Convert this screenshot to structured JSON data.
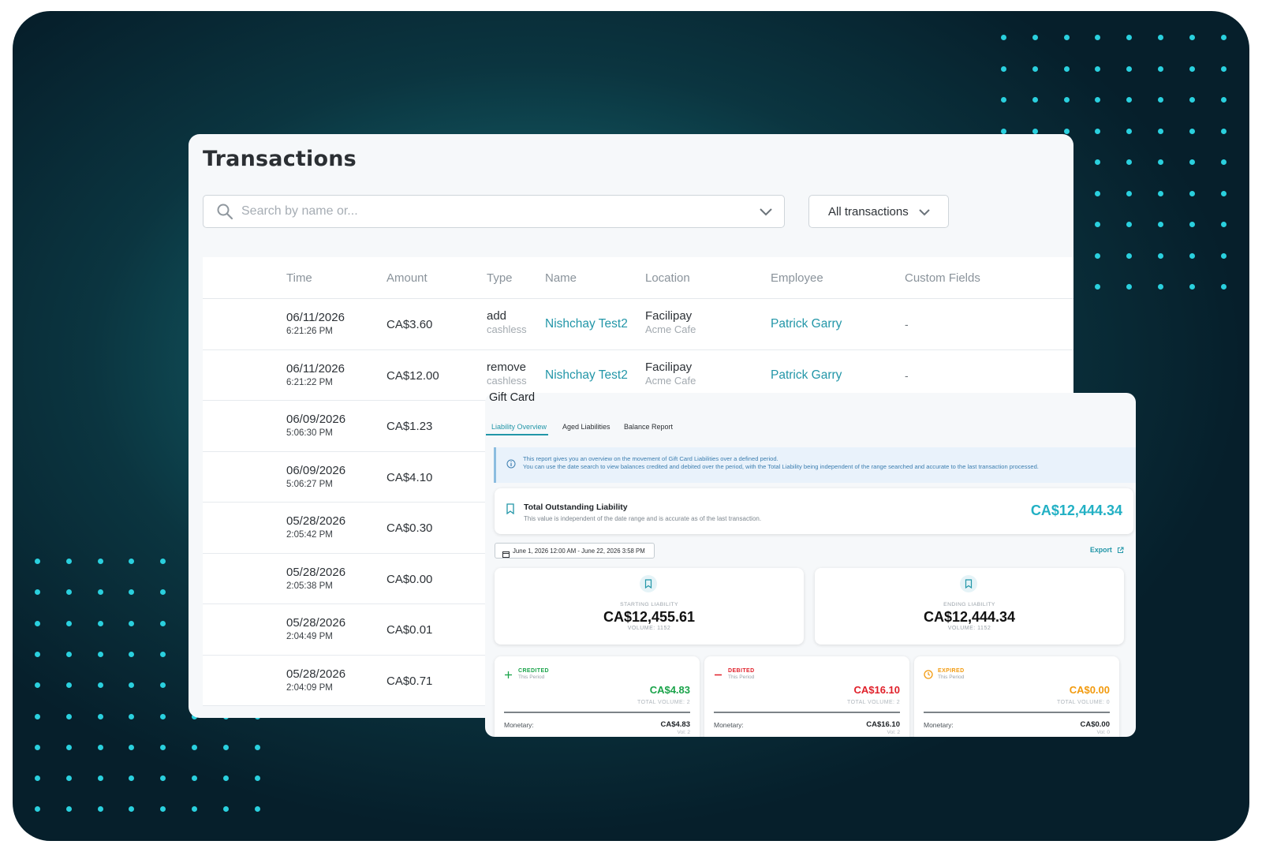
{
  "transactions": {
    "title": "Transactions",
    "search_placeholder": "Search by name or...",
    "filter_label": "All transactions",
    "columns": {
      "time": "Time",
      "amount": "Amount",
      "type": "Type",
      "name": "Name",
      "location": "Location",
      "employee": "Employee",
      "custom_fields": "Custom Fields"
    },
    "rows": [
      {
        "date": "06/11/2026",
        "time": "6:21:26 PM",
        "amount": "CA$3.60",
        "type": "add",
        "type_sub": "cashless",
        "name": "Nishchay Test2",
        "location": "Facilipay",
        "location_sub": "Acme Cafe",
        "employee": "Patrick Garry",
        "custom": "-"
      },
      {
        "date": "06/11/2026",
        "time": "6:21:22 PM",
        "amount": "CA$12.00",
        "type": "remove",
        "type_sub": "cashless",
        "name": "Nishchay Test2",
        "location": "Facilipay",
        "location_sub": "Acme Cafe",
        "employee": "Patrick Garry",
        "custom": "-"
      },
      {
        "date": "06/09/2026",
        "time": "5:06:30 PM",
        "amount": "CA$1.23"
      },
      {
        "date": "06/09/2026",
        "time": "5:06:27 PM",
        "amount": "CA$4.10"
      },
      {
        "date": "05/28/2026",
        "time": "2:05:42 PM",
        "amount": "CA$0.30"
      },
      {
        "date": "05/28/2026",
        "time": "2:05:38 PM",
        "amount": "CA$0.00"
      },
      {
        "date": "05/28/2026",
        "time": "2:04:49 PM",
        "amount": "CA$0.01"
      },
      {
        "date": "05/28/2026",
        "time": "2:04:09 PM",
        "amount": "CA$0.71"
      }
    ]
  },
  "gift_card": {
    "title": "Gift Card",
    "tabs": [
      "Liability Overview",
      "Aged Liabilities",
      "Balance Report"
    ],
    "info_line1": "This report gives you an overview on the movement of Gift Card Liabilities over a defined period.",
    "info_line2": "You can use the date search to view balances credited and debited over the period, with the Total Liability being independent of the range searched and accurate to the last transaction processed.",
    "total_title": "Total Outstanding Liability",
    "total_sub": "This value is independent of the date range and is accurate as of the last transaction.",
    "total_amount": "CA$12,444.34",
    "date_range": "June 1, 2026 12:00 AM - June 22, 2026 3:58 PM",
    "export_label": "Export",
    "starting": {
      "caption": "STARTING LIABILITY",
      "amount": "CA$12,455.61",
      "volume": "VOLUME: 1152"
    },
    "ending": {
      "caption": "ENDING LIABILITY",
      "amount": "CA$12,444.34",
      "volume": "VOLUME: 1152"
    },
    "credited": {
      "caption": "CREDITED",
      "sub": "This Period",
      "amount": "CA$4.83",
      "volume": "TOTAL VOLUME: 2",
      "monetary_label": "Monetary:",
      "monetary_value": "CA$4.83",
      "monetary_vol": "Vol: 2"
    },
    "debited": {
      "caption": "DEBITED",
      "sub": "This Period",
      "amount": "CA$16.10",
      "volume": "TOTAL VOLUME: 2",
      "monetary_label": "Monetary:",
      "monetary_value": "CA$16.10",
      "monetary_vol": "Vol: 2"
    },
    "expired": {
      "caption": "EXPIRED",
      "sub": "This Period",
      "amount": "CA$0.00",
      "volume": "TOTAL VOLUME: 0",
      "monetary_label": "Monetary:",
      "monetary_value": "CA$0.00",
      "monetary_vol": "Vol: 0"
    }
  },
  "colors": {
    "accent": "#2296a8",
    "credited": "#1aa34a",
    "debited": "#e0202a",
    "expired": "#f29a0e",
    "dots": "#2ad0de"
  }
}
